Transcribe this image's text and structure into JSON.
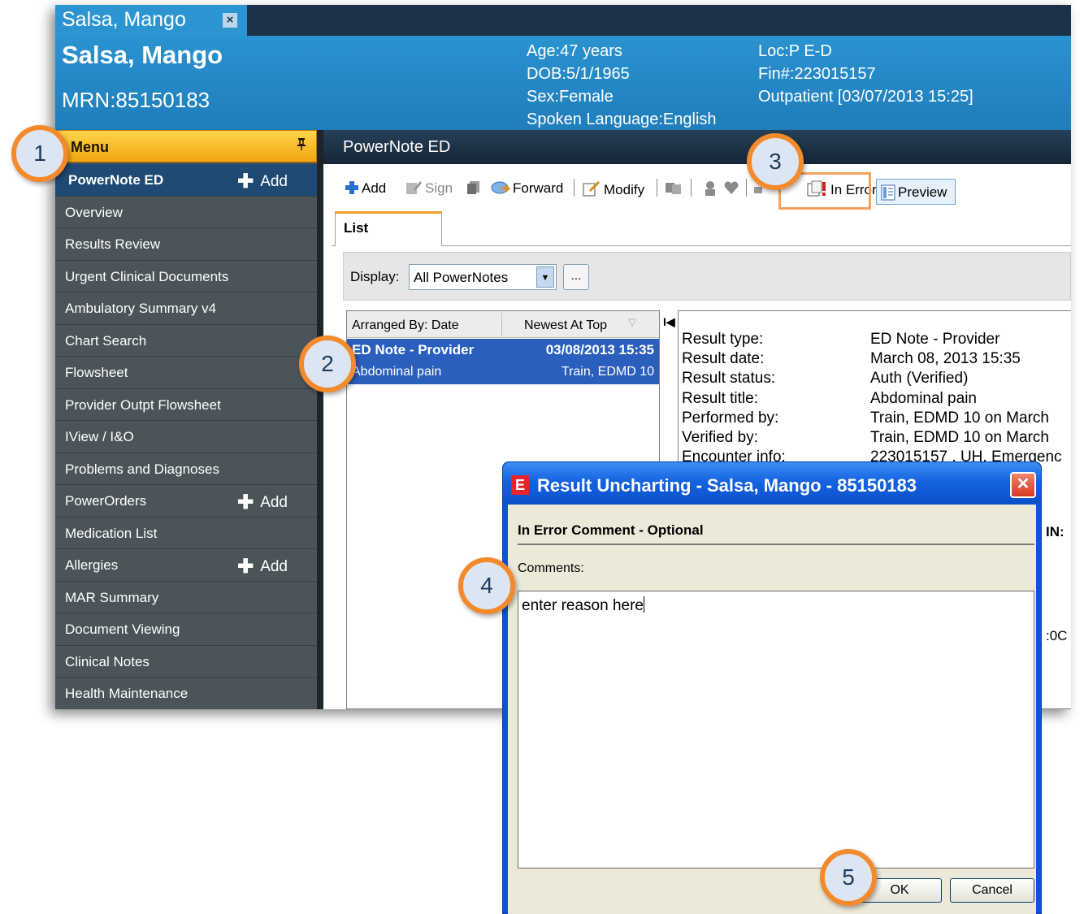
{
  "patient_tab": {
    "label": "Salsa, Mango",
    "close": "×"
  },
  "banner": {
    "name": "Salsa, Mango",
    "mrn": "MRN:85150183",
    "age": "Age:47 years",
    "dob": "DOB:5/1/1965",
    "sex": "Sex:Female",
    "language": "Spoken Language:English",
    "loc": "Loc:P E-D",
    "fin": "Fin#:223015157",
    "encounter": "Outpatient [03/07/2013 15:25]"
  },
  "menu": {
    "title": "Menu",
    "pin": "ᵖ",
    "add_label": "Add",
    "items": [
      {
        "label": "PowerNote ED"
      },
      {
        "label": "Overview"
      },
      {
        "label": "Results Review"
      },
      {
        "label": "Urgent Clinical Documents"
      },
      {
        "label": "Ambulatory Summary v4"
      },
      {
        "label": "Chart Search"
      },
      {
        "label": "Flowsheet"
      },
      {
        "label": "Provider Outpt Flowsheet"
      },
      {
        "label": "IView / I&O"
      },
      {
        "label": "Problems and Diagnoses"
      },
      {
        "label": "PowerOrders"
      },
      {
        "label": "Medication List"
      },
      {
        "label": "Allergies"
      },
      {
        "label": "MAR Summary"
      },
      {
        "label": "Document Viewing"
      },
      {
        "label": "Clinical Notes"
      },
      {
        "label": "Health Maintenance"
      }
    ]
  },
  "content": {
    "title": "PowerNote ED",
    "toolbar": {
      "add": "Add",
      "sign": "Sign",
      "forward": "Forward",
      "modify": "Modify",
      "in_error": "In Error",
      "preview": "Preview"
    },
    "tab_list": "List",
    "display": {
      "label": "Display:",
      "selected": "All PowerNotes",
      "more": "..."
    },
    "list": {
      "col_arranged": "Arranged By: Date",
      "col_newest": "Newest At Top",
      "rows": [
        {
          "left": "ED Note - Provider",
          "right": "03/08/2013 15:35"
        },
        {
          "left": "Abdominal pain",
          "right": "Train, EDMD 10"
        }
      ]
    },
    "preview": {
      "rows": [
        {
          "label": "Result type:",
          "value": "ED Note - Provider"
        },
        {
          "label": "Result date:",
          "value": "March 08, 2013 15:35"
        },
        {
          "label": "Result status:",
          "value": "Auth (Verified)"
        },
        {
          "label": "Result title:",
          "value": "Abdominal pain"
        },
        {
          "label": "Performed by:",
          "value": "Train, EDMD 10 on March"
        },
        {
          "label": "Verified by:",
          "value": "Train, EDMD 10 on March"
        },
        {
          "label": "Encounter info:",
          "value": "223015157 , UH, Emergenc"
        }
      ],
      "fragment_in": "IN:",
      "fragment_oc": ":0C"
    }
  },
  "dialog": {
    "icon": "E",
    "title": "Result Uncharting - Salsa, Mango - 85150183",
    "close": "✕",
    "section": "In Error Comment - Optional",
    "comments_label": "Comments:",
    "comment_value": "enter reason here",
    "ok": "OK",
    "cancel": "Cancel"
  },
  "callouts": [
    "1",
    "2",
    "3",
    "4",
    "5"
  ],
  "colors": {
    "accent_orange": "#f48a2c",
    "banner_blue": "#2a93d0",
    "selection_blue": "#2b5fbd"
  }
}
